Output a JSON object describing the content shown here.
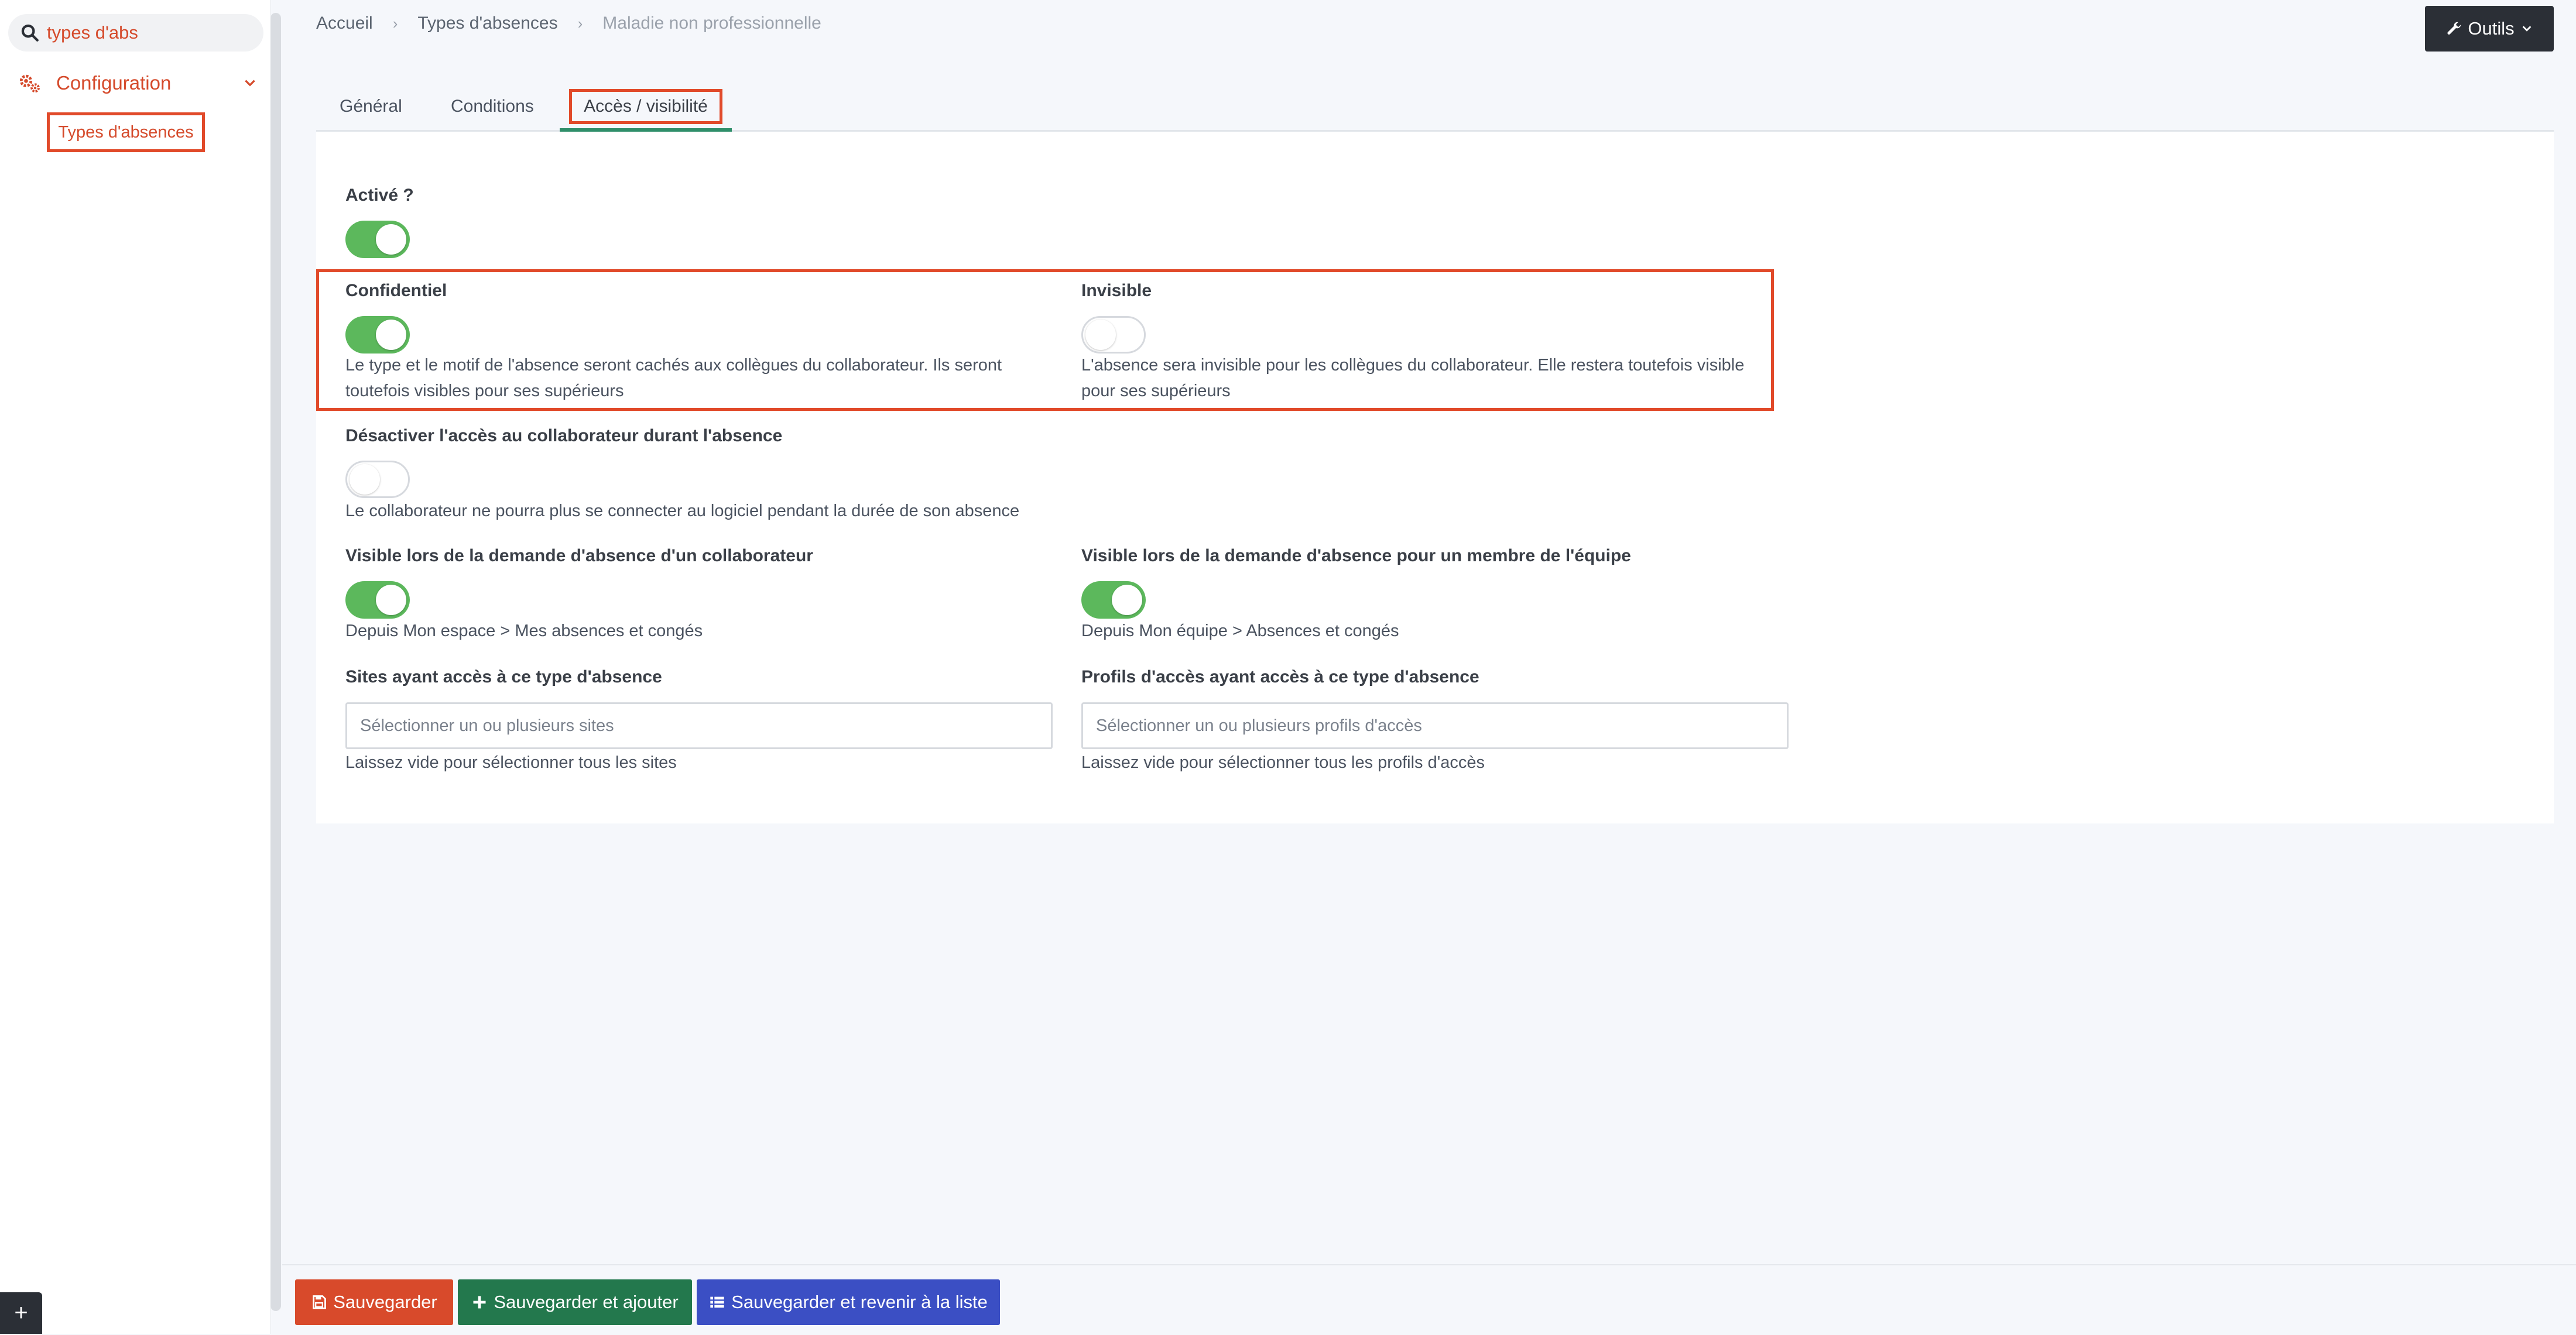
{
  "sidebar": {
    "search": {
      "value": "types d'abs",
      "icon": "search-icon"
    },
    "section": {
      "label": "Configuration",
      "icon": "gears-icon"
    },
    "item": {
      "label": "Types d'absences"
    },
    "corner_button": "+"
  },
  "breadcrumb": {
    "items": [
      "Accueil",
      "Types d'absences",
      "Maladie non professionnelle"
    ]
  },
  "tools": {
    "label": "Outils"
  },
  "tabs": [
    "Général",
    "Conditions",
    "Accès / visibilité"
  ],
  "form": {
    "active": {
      "label": "Activé ?",
      "checked": true
    },
    "confidential": {
      "label": "Confidentiel",
      "checked": true,
      "help_line1": "Le type et le motif de l'absence seront cachés aux collègues du collaborateur. Ils seront",
      "help_line2": "toutefois visibles pour ses supérieurs"
    },
    "invisible": {
      "label": "Invisible",
      "checked": false,
      "help_line1": "L'absence sera invisible pour les collègues du collaborateur. Elle restera toutefois visible",
      "help_line2": "pour ses supérieurs"
    },
    "disable_access": {
      "label": "Désactiver l'accès au collaborateur durant l'absence",
      "checked": false,
      "help": "Le collaborateur ne pourra plus se connecter au logiciel pendant la durée de son absence"
    },
    "visible_collab": {
      "label": "Visible lors de la demande d'absence d'un collaborateur",
      "checked": true,
      "help": "Depuis Mon espace > Mes absences et congés"
    },
    "visible_team": {
      "label": "Visible lors de la demande d'absence pour un membre de l'équipe",
      "checked": true,
      "help": "Depuis Mon équipe > Absences et congés"
    },
    "sites": {
      "label": "Sites ayant accès à ce type d'absence",
      "placeholder": "Sélectionner un ou plusieurs sites",
      "help": "Laissez vide pour sélectionner tous les sites"
    },
    "profiles": {
      "label": "Profils d'accès ayant accès à ce type d'absence",
      "placeholder": "Sélectionner un ou plusieurs profils d'accès",
      "help": "Laissez vide pour sélectionner tous les profils d'accès"
    }
  },
  "actions": {
    "save": "Sauvegarder",
    "save_add": "Sauvegarder et ajouter",
    "save_list": "Sauvegarder et revenir à la liste"
  },
  "colors": {
    "accent": "#d54a2b",
    "toggle_on": "#5cb85c",
    "save": "#d84a2b",
    "save_add": "#23784d",
    "save_list": "#3b4fc4"
  }
}
